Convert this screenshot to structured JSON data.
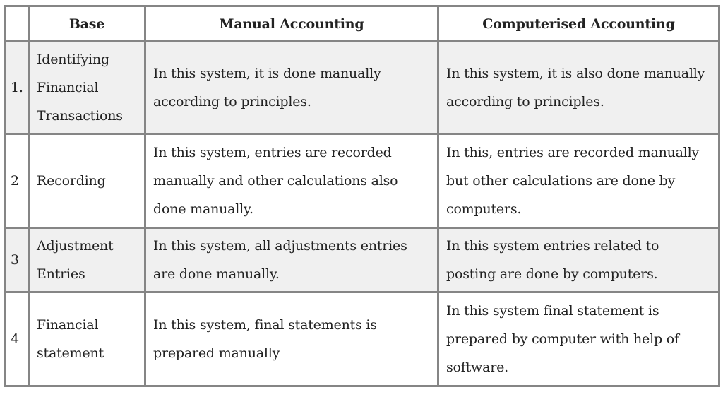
{
  "table": {
    "headers": [
      "",
      "Base",
      "Manual Accounting",
      "Computerised Accounting"
    ],
    "rows": [
      {
        "num": "1.",
        "base": "Identifying Financial Transactions",
        "manual": "In this system, it is done manually according to principles.",
        "computerised": "In this system, it is also done manually according to principles."
      },
      {
        "num": "2",
        "base": "Recording",
        "manual": "In this system, entries are recorded manually and other calculations also done manually.",
        "computerised": "In this, entries are recorded manually but other calculations are done by computers."
      },
      {
        "num": "3",
        "base": "Adjustment Entries",
        "manual": "In this system, all adjustments entries are done manually.",
        "computerised": "In this system entries related to posting are done by computers."
      },
      {
        "num": "4",
        "base": "Financial statement",
        "manual": "In this system, final statements is prepared manually",
        "computerised": "In this system final statement is prepared by computer with help of software."
      }
    ]
  }
}
